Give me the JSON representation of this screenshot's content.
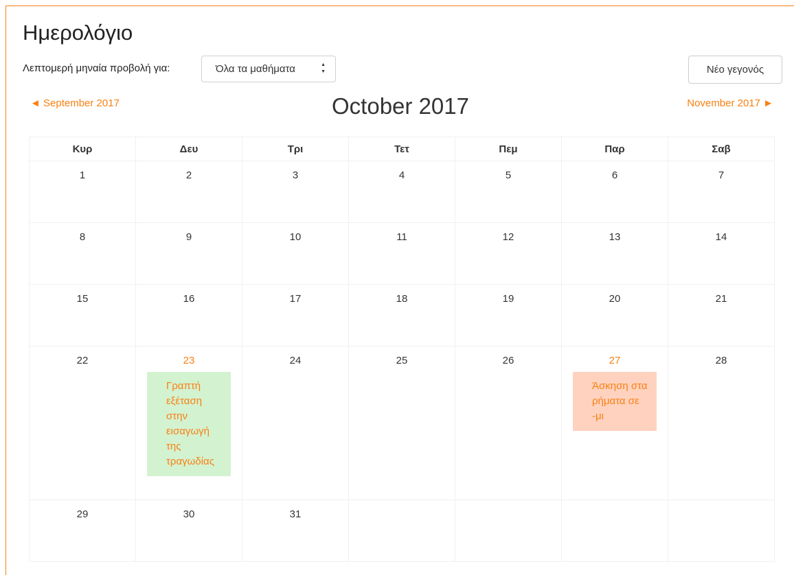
{
  "page": {
    "title": "Ημερολόγιο",
    "filter_label": "Λεπτομερή μηναία προβολή για:",
    "course_select": {
      "selected": "Όλα τα μαθήματα",
      "caret_up": "▲",
      "caret_down": "▼"
    },
    "new_event_label": "Νέο γεγονός"
  },
  "nav": {
    "prev": "◄ September 2017",
    "month": "October 2017",
    "next": "November 2017 ►"
  },
  "calendar": {
    "weekdays": [
      "Κυρ",
      "Δευ",
      "Τρι",
      "Τετ",
      "Πεμ",
      "Παρ",
      "Σαβ"
    ],
    "weeks": [
      [
        "1",
        "2",
        "3",
        "4",
        "5",
        "6",
        "7"
      ],
      [
        "8",
        "9",
        "10",
        "11",
        "12",
        "13",
        "14"
      ],
      [
        "15",
        "16",
        "17",
        "18",
        "19",
        "20",
        "21"
      ],
      [
        "22",
        "23",
        "24",
        "25",
        "26",
        "27",
        "28"
      ],
      [
        "29",
        "30",
        "31",
        "",
        "",
        "",
        ""
      ]
    ],
    "events": {
      "oct23": "Γραπτή εξέταση στην εισαγωγή της τραγωδίας",
      "oct27": "Άσκηση στα ρήματα σε -μι"
    }
  },
  "colors": {
    "accent": "#f98012",
    "event_course": "#d3f2d0",
    "event_user": "#ffd2bf"
  }
}
